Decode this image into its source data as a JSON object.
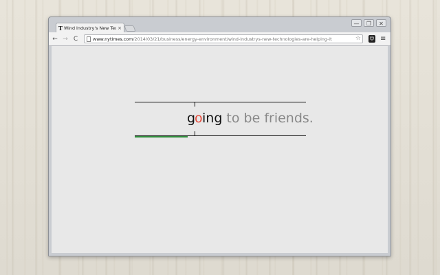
{
  "browser": {
    "tab": {
      "favicon": "T",
      "title": "Wind Industry's New Tec",
      "close_glyph": "×"
    },
    "window_controls": {
      "minimize": "—",
      "maximize": "❐",
      "close": "✕"
    },
    "toolbar": {
      "back_glyph": "←",
      "forward_glyph": "→",
      "reload_glyph": "C",
      "url_host": "www.nytimes.com",
      "url_path": "/2014/03/21/business/energy-environment/wind-industrys-new-technologies-are-helping-it",
      "star_glyph": "☆",
      "extension_glyph": "☺",
      "menu_glyph": "≡"
    }
  },
  "reader": {
    "word_before_focus": "g",
    "focus_letter": "o",
    "word_after_focus": "ing",
    "upcoming_text": " to be friends.",
    "progress": 0.31,
    "colors": {
      "focus_letter": "#e64a3b",
      "progress_bar": "#2e8b3a",
      "upcoming_text": "#888888"
    }
  }
}
